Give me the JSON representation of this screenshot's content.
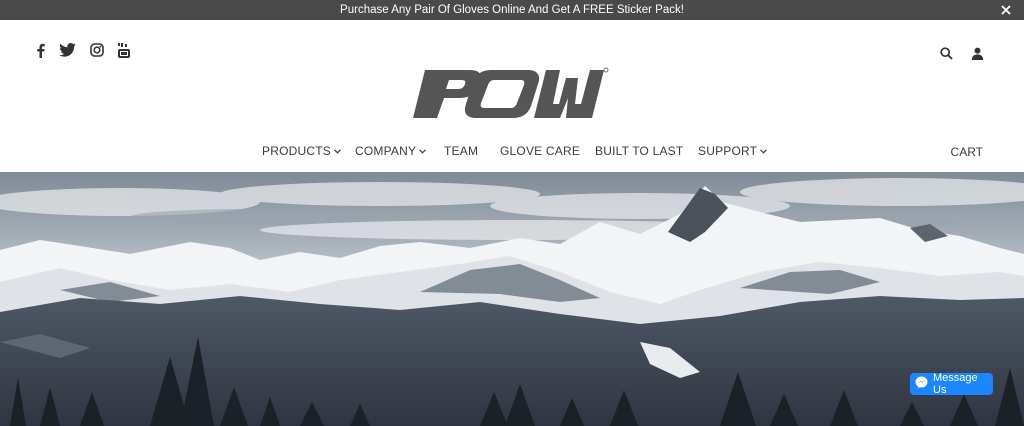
{
  "announcement": {
    "text": "Purchase Any Pair Of Gloves Online And Get A FREE Sticker Pack!",
    "close_icon": "close-icon"
  },
  "social_icons": [
    "facebook-icon",
    "twitter-icon",
    "instagram-icon",
    "youtube-icon"
  ],
  "utility_icons": [
    "search-icon",
    "account-icon"
  ],
  "brand": {
    "logo_text": "POW"
  },
  "nav": {
    "items": [
      {
        "label": "PRODUCTS",
        "dropdown": true
      },
      {
        "label": "COMPANY",
        "dropdown": true
      },
      {
        "label": "TEAM",
        "dropdown": false
      },
      {
        "label": "GLOVE CARE",
        "dropdown": false
      },
      {
        "label": "BUILT TO LAST",
        "dropdown": false
      },
      {
        "label": "SUPPORT",
        "dropdown": true
      }
    ],
    "cart_label": "CART"
  },
  "messenger": {
    "label": "Message Us",
    "icon": "messenger-icon",
    "color": "#1b86ff"
  },
  "colors": {
    "announcement_bg": "#4a4a4a",
    "text": "#3b3b3b",
    "logo": "#555555"
  }
}
